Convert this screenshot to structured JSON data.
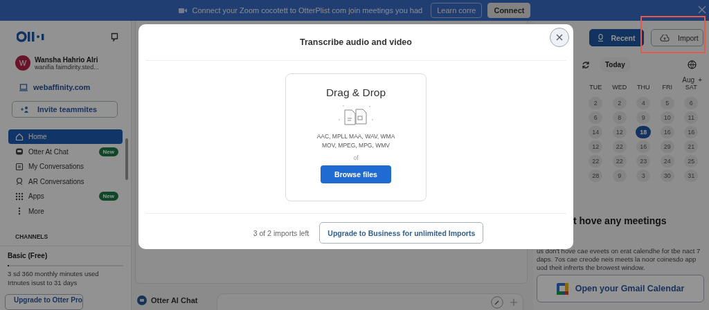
{
  "banner": {
    "message": "Connect your Zoom cocotett to OtterPlist com join meetings you had",
    "buttons": [
      {
        "label": "Learn corre",
        "kind": "outline"
      },
      {
        "label": "Connect",
        "kind": "filled"
      }
    ]
  },
  "sidebar": {
    "user": {
      "initial": "W",
      "name": "Wansha Hahrio Alri",
      "email": "wanifia faimdirity.sted..."
    },
    "workspace": "webaffinity.com",
    "invite_button": "Invite teammites",
    "nav": [
      {
        "label": "Home",
        "kind": "home",
        "selected": true
      },
      {
        "label": "Otter At Chat",
        "kind": "chat",
        "selected": false,
        "badge": "New"
      },
      {
        "label": "My Conversations",
        "kind": "list",
        "selected": false
      },
      {
        "label": "AR Conversations",
        "kind": "people",
        "selected": false
      },
      {
        "label": "Apps",
        "kind": "apps",
        "selected": false,
        "badge": "New"
      },
      {
        "label": "More",
        "kind": "more",
        "selected": false
      }
    ],
    "section_heading": "CHANNELS",
    "plan": {
      "name": "Basic (Free)",
      "level": 0.01,
      "usage": "3 sd 360 monthly minutes used",
      "reset": "Irtnutes isust to 31 days"
    },
    "upgrade_button": "Upgrade to Otter Pro"
  },
  "header": {
    "buttons": [
      {
        "label": "Recent",
        "kind": "primary",
        "highlighted": false
      },
      {
        "label": "Import",
        "kind": "outline",
        "highlighted": true
      }
    ]
  },
  "calendar": {
    "today_button": "Today",
    "month": "Aug",
    "add": "+",
    "weekdays": [
      "TUE",
      "WED",
      "THU",
      "FRI",
      "SAT"
    ],
    "weeks": [
      [
        {
          "day": "2",
          "selected": false
        },
        {
          "day": "2",
          "selected": false
        },
        {
          "day": "4",
          "selected": false
        },
        {
          "day": "5",
          "selected": false
        },
        {
          "day": "6",
          "selected": false
        }
      ],
      [
        {
          "day": "6",
          "selected": false
        },
        {
          "day": "8",
          "selected": false
        },
        {
          "day": "9",
          "selected": false
        },
        {
          "day": "10",
          "selected": false
        },
        {
          "day": "11",
          "selected": false
        }
      ],
      [
        {
          "day": "14",
          "selected": false
        },
        {
          "day": "12",
          "selected": false
        },
        {
          "day": "18",
          "selected": true
        },
        {
          "day": "16",
          "selected": false
        },
        {
          "day": "16",
          "selected": false
        }
      ],
      [
        {
          "day": "12",
          "selected": false
        },
        {
          "day": "22",
          "selected": false
        },
        {
          "day": "16",
          "selected": false
        },
        {
          "day": "29",
          "selected": false
        },
        {
          "day": "21",
          "selected": false
        }
      ],
      [
        {
          "day": "22",
          "selected": false
        },
        {
          "day": "22",
          "selected": false
        },
        {
          "day": "23",
          "selected": false
        },
        {
          "day": "24",
          "selected": false
        },
        {
          "day": "25",
          "selected": false
        }
      ],
      [
        {
          "day": "28",
          "selected": false
        },
        {
          "day": "9",
          "selected": false
        },
        {
          "day": "3",
          "selected": false
        },
        {
          "day": "30",
          "selected": false
        },
        {
          "day": "31",
          "selected": false
        }
      ]
    ]
  },
  "meetings": {
    "heading": "t hove any meetings",
    "description": "us don't hove cae eveets on erat calendhe for tbe nact 7 daps. 7os cae creode neis meets la noor coinesdo app uod theit infrerts the browest window.",
    "gmail_button": "Open your Gmail Calendar"
  },
  "chat": {
    "title": "Otter AI Chat"
  },
  "modal": {
    "title": "Transcribe audio and video",
    "drop_title": "Drag & Drop",
    "formats": [
      "AAC, MPLL MAA, WAV, WMA",
      "MOV, MPEG, MPG, WMV"
    ],
    "separator": "of",
    "browse_button": "Browse files",
    "quota": "3 of 2 imports left",
    "upgrade_button": "Upgrade to Business for unlimited Imports"
  }
}
